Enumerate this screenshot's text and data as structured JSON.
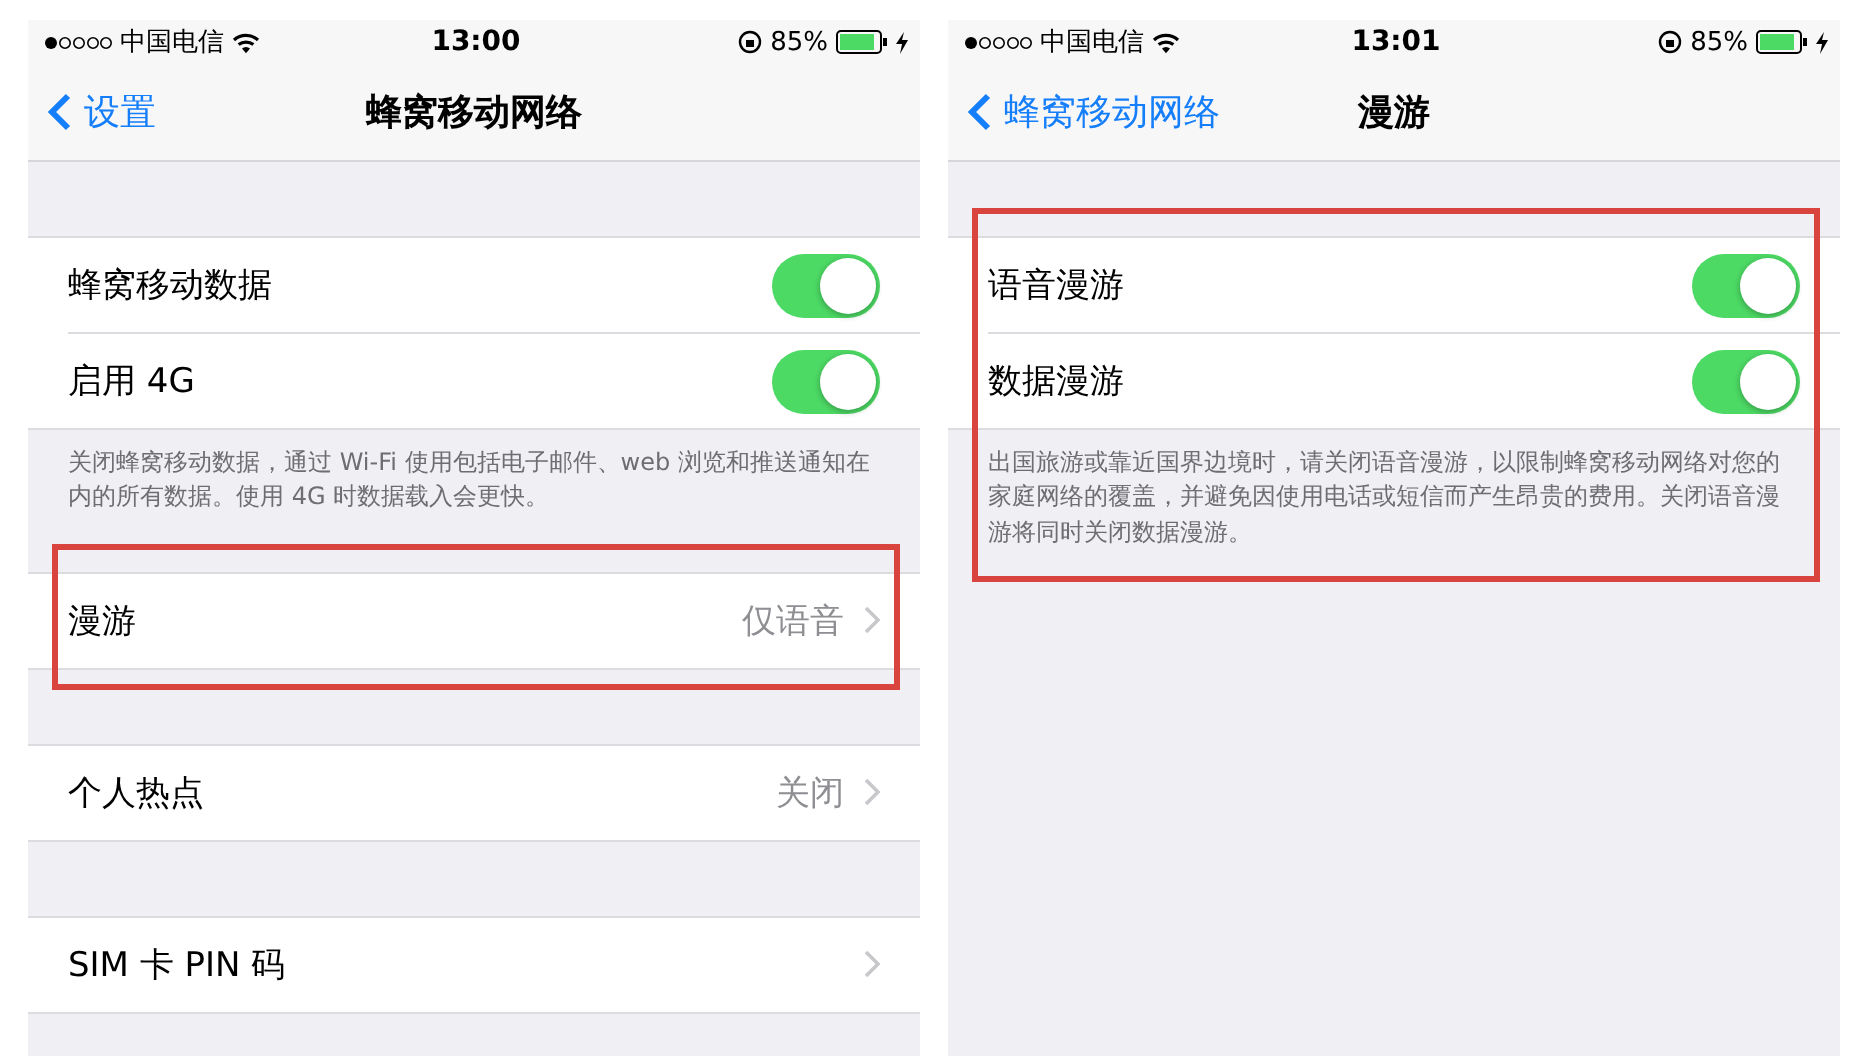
{
  "panels": [
    {
      "status_bar": {
        "carrier": "中国电信",
        "time": "13:00",
        "battery": "85%"
      },
      "nav": {
        "back": "设置",
        "title": "蜂窝移动网络"
      },
      "sections": [
        {
          "highlighted": false,
          "rows": [
            {
              "kind": "toggle",
              "label": "蜂窝移动数据",
              "on": true
            },
            {
              "kind": "toggle",
              "label": "启用 4G",
              "on": true
            }
          ],
          "footer": "关闭蜂窝移动数据，通过 Wi-Fi 使用包括电子邮件、web 浏览和推送通知在内的所有数据。使用 4G 时数据载入会更快。"
        },
        {
          "highlighted": true,
          "rows": [
            {
              "kind": "link",
              "label": "漫游",
              "value": "仅语音"
            }
          ]
        },
        {
          "highlighted": false,
          "rows": [
            {
              "kind": "link",
              "label": "个人热点",
              "value": "关闭"
            }
          ]
        },
        {
          "highlighted": false,
          "rows": [
            {
              "kind": "link",
              "label": "SIM 卡 PIN 码"
            }
          ]
        }
      ]
    },
    {
      "status_bar": {
        "carrier": "中国电信",
        "time": "13:01",
        "battery": "85%"
      },
      "nav": {
        "back": "蜂窝移动网络",
        "title": "漫游"
      },
      "sections": [
        {
          "highlighted": true,
          "rows": [
            {
              "kind": "toggle",
              "label": "语音漫游",
              "on": true
            },
            {
              "kind": "toggle",
              "label": "数据漫游",
              "on": true
            }
          ],
          "footer": "出国旅游或靠近国界边境时，请关闭语音漫游，以限制蜂窝移动网络对您的家庭网络的覆盖，并避免因使用电话或短信而产生昂贵的费用。关闭语音漫游将同时关闭数据漫游。"
        }
      ]
    }
  ]
}
